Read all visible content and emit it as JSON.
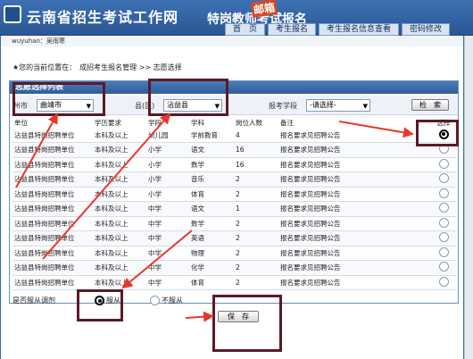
{
  "header": {
    "title": "云南省招生考试工作网",
    "subtitle": "特岗教师考试报名",
    "stamp": "邮箱",
    "nav": [
      "首　页",
      "考生报名",
      "考生报名信息查看",
      "密码修改"
    ]
  },
  "user_strip": "wuyuhan：吴雨寒",
  "breadcrumb": "★您的当前位置在：　成招考生报名管理 >> 志愿选择",
  "panel": {
    "title": "志愿选择列表",
    "filters": {
      "city_label": "州市",
      "city_value": "曲靖市",
      "county_label": "县(区)",
      "county_value": "沾益县",
      "school_label": "报考学段",
      "school_value": "-请选择-"
    },
    "query_button": "检　索"
  },
  "table": {
    "headers": [
      "单位",
      "学历要求",
      "学段",
      "学科",
      "岗位人数",
      "备注",
      "选择"
    ],
    "rows": [
      {
        "unit": "沾益县特岗招聘单位",
        "edu": "本科及以上",
        "stage": "幼儿园",
        "subject": "学前教育",
        "count": "4",
        "note": "报名要求见招聘公告",
        "selected": true
      },
      {
        "unit": "沾益县特岗招聘单位",
        "edu": "本科及以上",
        "stage": "小学",
        "subject": "语文",
        "count": "16",
        "note": "报名要求见招聘公告",
        "selected": false
      },
      {
        "unit": "沾益县特岗招聘单位",
        "edu": "本科及以上",
        "stage": "小学",
        "subject": "数学",
        "count": "16",
        "note": "报名要求见招聘公告",
        "selected": false
      },
      {
        "unit": "沾益县特岗招聘单位",
        "edu": "本科及以上",
        "stage": "小学",
        "subject": "音乐",
        "count": "2",
        "note": "报名要求见招聘公告",
        "selected": false
      },
      {
        "unit": "沾益县特岗招聘单位",
        "edu": "本科及以上",
        "stage": "小学",
        "subject": "体育",
        "count": "2",
        "note": "报名要求见招聘公告",
        "selected": false
      },
      {
        "unit": "沾益县特岗招聘单位",
        "edu": "本科及以上",
        "stage": "中学",
        "subject": "语文",
        "count": "1",
        "note": "报名要求见招聘公告",
        "selected": false
      },
      {
        "unit": "沾益县特岗招聘单位",
        "edu": "本科及以上",
        "stage": "中学",
        "subject": "数学",
        "count": "2",
        "note": "报名要求见招聘公告",
        "selected": false
      },
      {
        "unit": "沾益县特岗招聘单位",
        "edu": "本科及以上",
        "stage": "中学",
        "subject": "英语",
        "count": "2",
        "note": "报名要求见招聘公告",
        "selected": false
      },
      {
        "unit": "沾益县特岗招聘单位",
        "edu": "本科及以上",
        "stage": "中学",
        "subject": "物理",
        "count": "2",
        "note": "报名要求见招聘公告",
        "selected": false
      },
      {
        "unit": "沾益县特岗招聘单位",
        "edu": "本科及以上",
        "stage": "中学",
        "subject": "化学",
        "count": "2",
        "note": "报名要求见招聘公告",
        "selected": false
      },
      {
        "unit": "沾益县特岗招聘单位",
        "edu": "本科及以上",
        "stage": "中学",
        "subject": "体育",
        "count": "2",
        "note": "报名要求见招聘公告",
        "selected": false
      }
    ]
  },
  "obey": {
    "label": "是否服从调剂",
    "yes": "服从",
    "no": "不服从",
    "selected": "yes"
  },
  "save_button": "保　存",
  "colors": {
    "header": "#2f5f9e",
    "annotation_box": "#5b1a26",
    "annotation_arrow": "#e8362c"
  }
}
